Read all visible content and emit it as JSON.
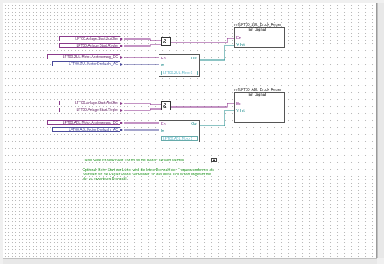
{
  "section1": {
    "inputs": {
      "start_zuluefter": "LFT00.Anlage.Start.Zulüfter",
      "start_regler": "LFT00.Anlage.Start.Regler",
      "motor_ansteuerung": "LFT00.ZUL.Motor.Ansteuerung_DO",
      "motor_drehzahl": "LFT00.ZUL.Motor.Drehzahl_AO"
    },
    "and_gate": "&",
    "motor_block": {
      "pin_en": "En",
      "pin_in": "In",
      "pin_out": "Out",
      "instance": "LFT00.ZUL.Motor1"
    },
    "regler_block": {
      "ref": "ref.LFT00_ZUL_Druck_Regler",
      "title": "Init Signal",
      "pin_en": "En",
      "pin_yinit": "Y.Init"
    }
  },
  "section2": {
    "inputs": {
      "start_abluefter": "LFT00.Anlage.Start.Ablüfter",
      "start_regler": "LFT00.Anlage.Start.Regler",
      "motor_ansteuerung": "LFT00.ABL.Motor.Ansteuerung_DO",
      "motor_drehzahl": "LFT00.ABL.Motor.Drehzahl_AO"
    },
    "and_gate": "&",
    "motor_block": {
      "pin_en": "En",
      "pin_in": "In",
      "pin_out": "Out",
      "instance": "LFT00.ABL.Motor1"
    },
    "regler_block": {
      "ref": "ref.LFT00_ABL_Druck_Regler",
      "title": "Init Signal",
      "pin_en": "En",
      "pin_yinit": "Y.Init"
    }
  },
  "notes": {
    "line1": "Diese Seite ist deaktiviert und muss bei Bedarf aktiviert werden.",
    "line2": "Optional: Beim Start der Lüfter wird die letzte Drehzahl der Frequenzumformer als\nStartwert für die Regler wieder verwendet, so das diese sich schon ungefähr mit\nder zu erwarteten Drehzahl"
  },
  "colors": {
    "digital_wire": "#8a2a8a",
    "analog_wire": "#1a8a8a",
    "note_text": "#2a9a2a"
  }
}
